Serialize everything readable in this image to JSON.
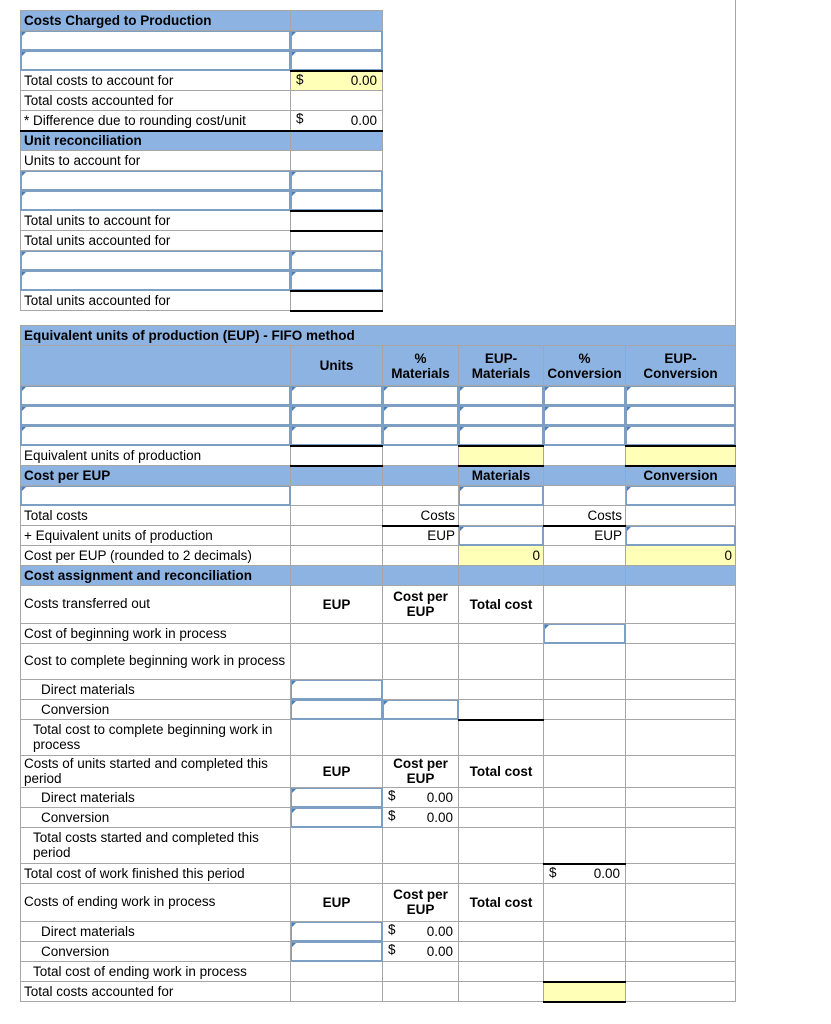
{
  "colors": {
    "header_blue": "#8db3e2",
    "highlight_yellow": "#ffffb8",
    "grid": "#a6a6a6",
    "selection_border": "#7d9fc4"
  },
  "section_costs_charged": {
    "title": "Costs Charged to Production",
    "rows": [
      {
        "label": "",
        "value": "",
        "input": true
      },
      {
        "label": "",
        "value": "",
        "input": true
      },
      {
        "label": "Total costs to account for",
        "dollar": "$",
        "value": "0.00",
        "fill": "yellow"
      },
      {
        "label": "Total costs accounted for",
        "value": ""
      },
      {
        "label": "* Difference due to rounding cost/unit",
        "dollar": "$",
        "value": "0.00"
      }
    ]
  },
  "section_unit_reconciliation": {
    "title": "Unit reconciliation",
    "rows": [
      {
        "label": "Units to account for",
        "value": ""
      },
      {
        "label": "",
        "value": "",
        "input": true
      },
      {
        "label": "",
        "value": "",
        "input": true
      },
      {
        "label": "Total units to account for",
        "value": ""
      },
      {
        "label": "Total units accounted for",
        "value": ""
      },
      {
        "label": "",
        "value": "",
        "input": true
      },
      {
        "label": "",
        "value": "",
        "input": true
      },
      {
        "label": "Total units accounted for",
        "value": ""
      }
    ]
  },
  "section_eup": {
    "title": "Equivalent units of production (EUP) - FIFO method",
    "columns": [
      "",
      "Units",
      "% Materials",
      "EUP- Materials",
      "% Conversion",
      "EUP- Conversion"
    ],
    "column_lines": [
      {
        "line1": "",
        "line2": ""
      },
      {
        "line1": "",
        "line2": "Units"
      },
      {
        "line1": "%",
        "line2": "Materials"
      },
      {
        "line1": "EUP-",
        "line2": "Materials"
      },
      {
        "line1": "%",
        "line2": "Conversion"
      },
      {
        "line1": "EUP-",
        "line2": "Conversion"
      }
    ],
    "rows": [
      {
        "label": "",
        "cells": [
          "",
          "",
          "",
          "",
          ""
        ],
        "input": true
      },
      {
        "label": "",
        "cells": [
          "",
          "",
          "",
          "",
          ""
        ],
        "input": true
      },
      {
        "label": "",
        "cells": [
          "",
          "",
          "",
          "",
          ""
        ],
        "input": true
      },
      {
        "label": "Equivalent units of production",
        "cells": [
          "",
          "",
          "",
          "",
          ""
        ],
        "total": true
      }
    ]
  },
  "section_cost_per_eup": {
    "title": "Cost per EUP",
    "header_materials": "Materials",
    "header_conversion": "Conversion",
    "rows": [
      {
        "label": "",
        "c1": "",
        "c2": "",
        "c3": "",
        "c4": "",
        "c5": "",
        "input": true
      },
      {
        "label": "Total costs",
        "c1": "",
        "c2": "Costs",
        "c3": "",
        "c4": "Costs",
        "c5": ""
      },
      {
        "label": "+ Equivalent units of production",
        "c1": "",
        "c2": "EUP",
        "c3": "",
        "c4": "EUP",
        "c5": ""
      },
      {
        "label": "Cost per EUP (rounded to 2 decimals)",
        "c1": "",
        "c2": "",
        "c3": "0",
        "c4": "",
        "c5": "0"
      }
    ]
  },
  "section_cost_assignment": {
    "title": "Cost assignment and reconciliation",
    "group_headers": {
      "eup": "EUP",
      "cost_per_eup": "Cost per EUP",
      "total_cost": "Total cost"
    },
    "blocks": [
      {
        "heading": "Costs transferred out",
        "rows": [
          {
            "label": "Cost of beginning work in process",
            "eup": "",
            "cpe": "",
            "total": "",
            "c5": "",
            "c5_input": true
          },
          {
            "label": "Cost to complete beginning work in process",
            "eup": "",
            "cpe": "",
            "total": "",
            "c5": ""
          },
          {
            "label": "Direct materials",
            "indent": 1,
            "eup": "",
            "cpe": "",
            "total": "",
            "c5": "",
            "eup_input": true
          },
          {
            "label": "Conversion",
            "indent": 1,
            "eup": "",
            "cpe": "",
            "total": "",
            "c5": "",
            "eup_input": true,
            "cpe_input": true
          },
          {
            "label": "Total cost to complete beginning work in process",
            "indent": 1,
            "eup": "",
            "cpe": "",
            "total": "",
            "c5": ""
          }
        ]
      },
      {
        "heading": "Costs of units started and completed this period",
        "rows": [
          {
            "label": "Direct materials",
            "indent": 1,
            "eup": "",
            "cpe_dollar": "$",
            "cpe": "0.00",
            "total": "",
            "c5": "",
            "eup_input": true
          },
          {
            "label": "Conversion",
            "indent": 1,
            "eup": "",
            "cpe_dollar": "$",
            "cpe": "0.00",
            "total": "",
            "c5": "",
            "eup_input": true
          },
          {
            "label": "Total costs started and completed this period",
            "indent": 1,
            "eup": "",
            "cpe": "",
            "total": "",
            "c5": ""
          },
          {
            "label": "Total cost of work finished this period",
            "eup": "",
            "cpe": "",
            "total": "",
            "c5_dollar": "$",
            "c5": "0.00"
          }
        ]
      },
      {
        "heading": "Costs of ending work in process",
        "rows": [
          {
            "label": "Direct materials",
            "indent": 1,
            "eup": "",
            "cpe_dollar": "$",
            "cpe": "0.00",
            "total": "",
            "c5": "",
            "eup_input": true
          },
          {
            "label": "Conversion",
            "indent": 1,
            "eup": "",
            "cpe_dollar": "$",
            "cpe": "0.00",
            "total": "",
            "c5": "",
            "eup_input": true
          },
          {
            "label": "Total cost of ending work in process",
            "indent": 1,
            "eup": "",
            "cpe": "",
            "total": "",
            "c5": ""
          },
          {
            "label": "Total costs accounted for",
            "eup": "",
            "cpe": "",
            "total": "",
            "c5": "",
            "c5_fill": "yellow"
          }
        ]
      }
    ]
  }
}
